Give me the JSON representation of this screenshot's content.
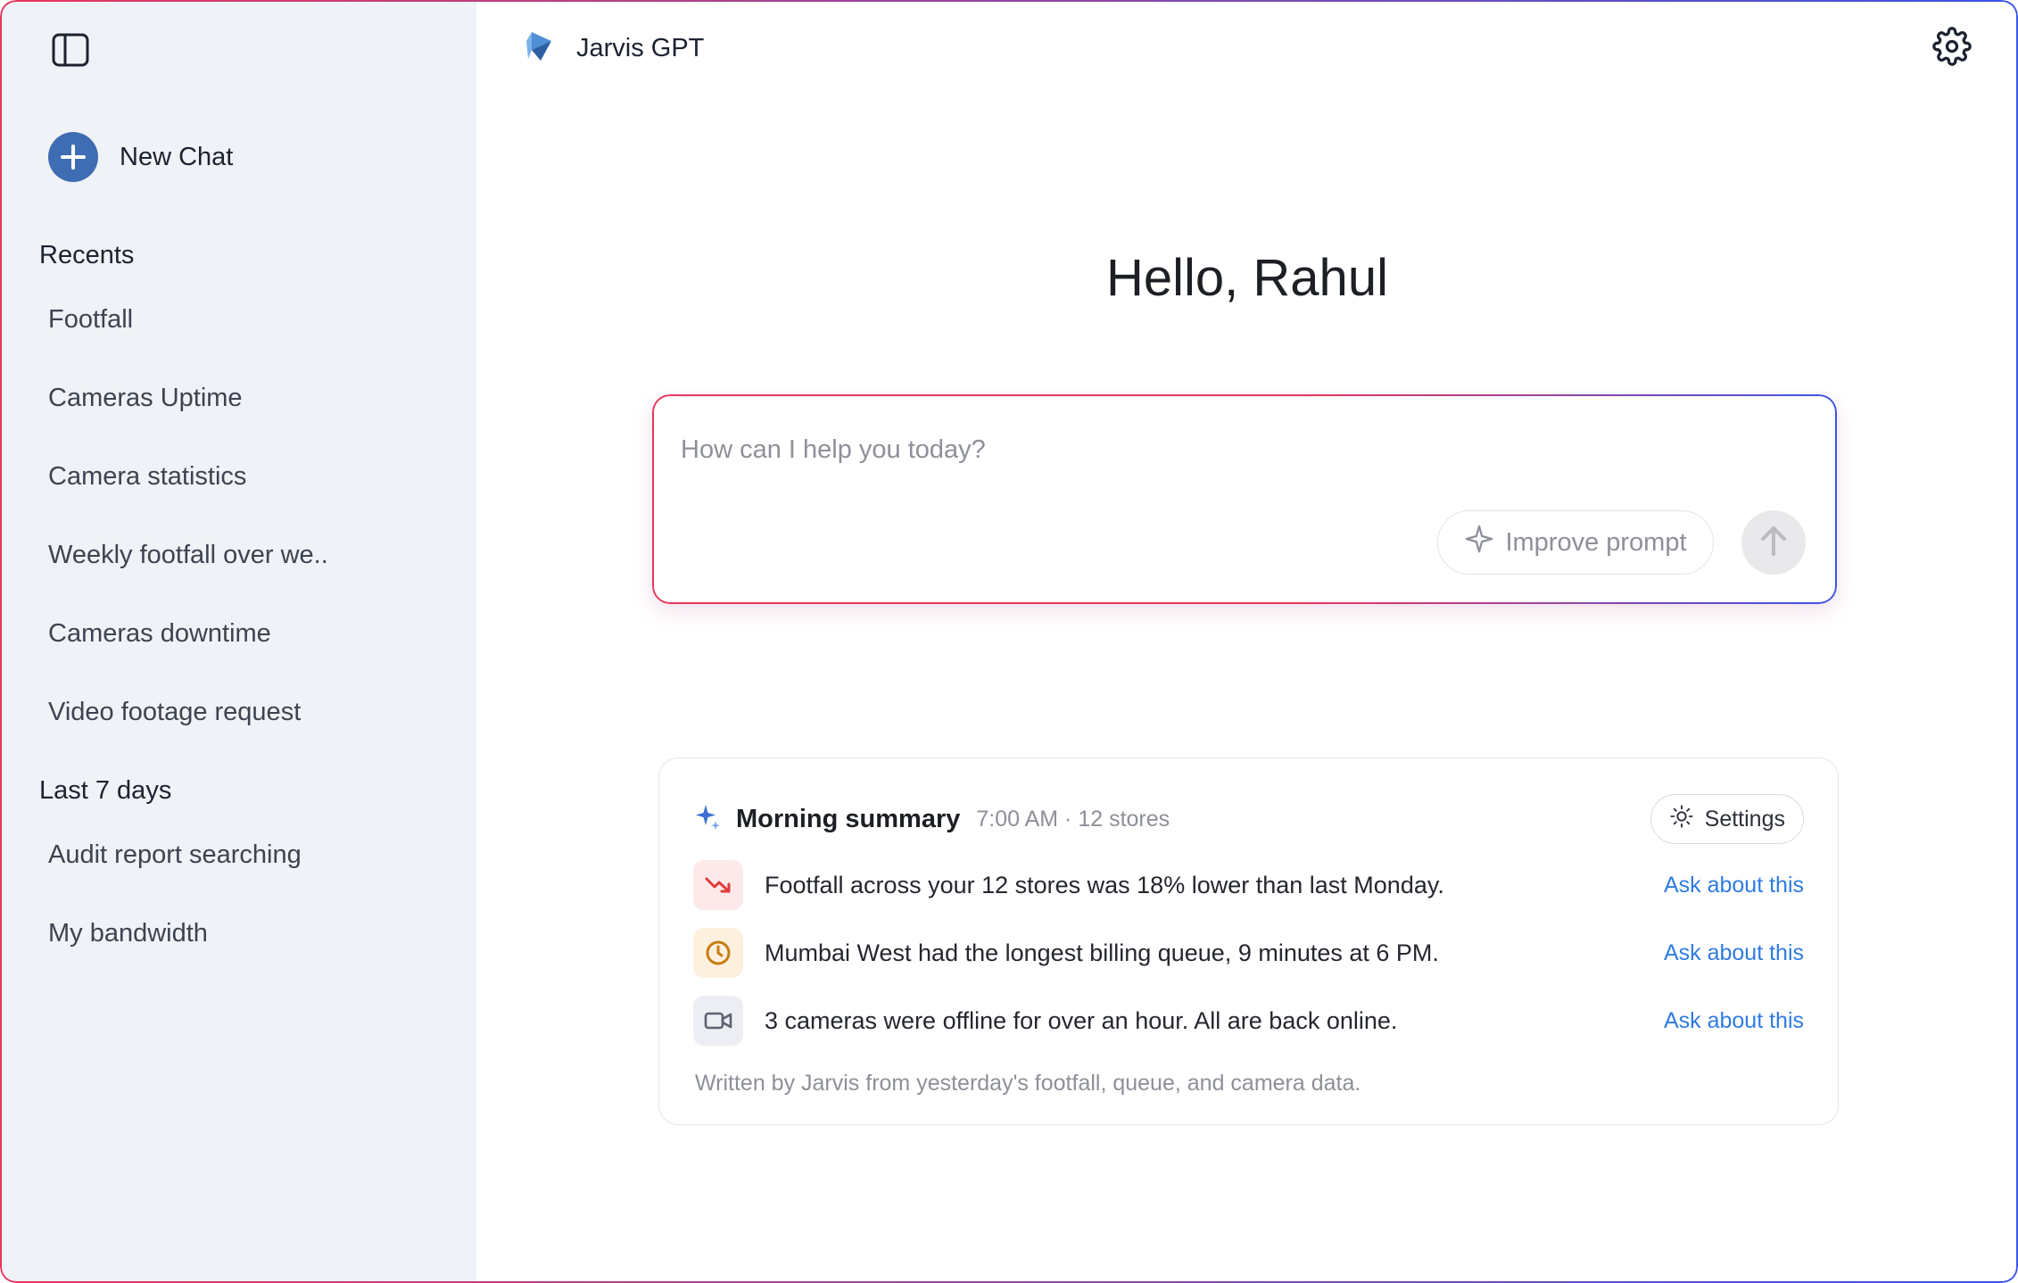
{
  "sidebar": {
    "new_chat_label": "New Chat",
    "recents_title": "Recents",
    "recents": [
      {
        "label": "Footfall"
      },
      {
        "label": "Cameras Uptime"
      },
      {
        "label": "Camera statistics"
      },
      {
        "label": "Weekly footfall over we.."
      },
      {
        "label": "Cameras downtime"
      },
      {
        "label": "Video footage request"
      }
    ],
    "last7_title": "Last 7 days",
    "last7": [
      {
        "label": "Audit report searching"
      },
      {
        "label": "My bandwidth"
      }
    ]
  },
  "header": {
    "app_name": "Jarvis GPT"
  },
  "main": {
    "greeting": "Hello, Rahul",
    "prompt": {
      "placeholder": "How can I help you today?",
      "value": "",
      "improve_label": "Improve prompt"
    }
  },
  "summary": {
    "title": "Morning summary",
    "meta": "7:00 AM · 12 stores",
    "settings_label": "Settings",
    "items": [
      {
        "icon": "trending-down-icon",
        "text": "Footfall across your 12 stores was 18% lower than last Monday.",
        "link": "Ask about this"
      },
      {
        "icon": "clock-icon",
        "text": "Mumbai West had the longest billing queue, 9 minutes at 6 PM.",
        "link": "Ask about this"
      },
      {
        "icon": "video-camera-icon",
        "text": "3 cameras were offline for over an hour. All are back online.",
        "link": "Ask about this"
      }
    ],
    "footer": "Written by Jarvis from yesterday's footfall, queue, and camera data."
  },
  "colors": {
    "accent_blue": "#3f6db3",
    "link_blue": "#2f7be2",
    "gradient_pink": "#e8365d",
    "gradient_blue": "#3b55e6",
    "sidebar_bg": "#eff2f7",
    "alert_red": "#e03b3b",
    "warning_amber": "#c77d11"
  }
}
